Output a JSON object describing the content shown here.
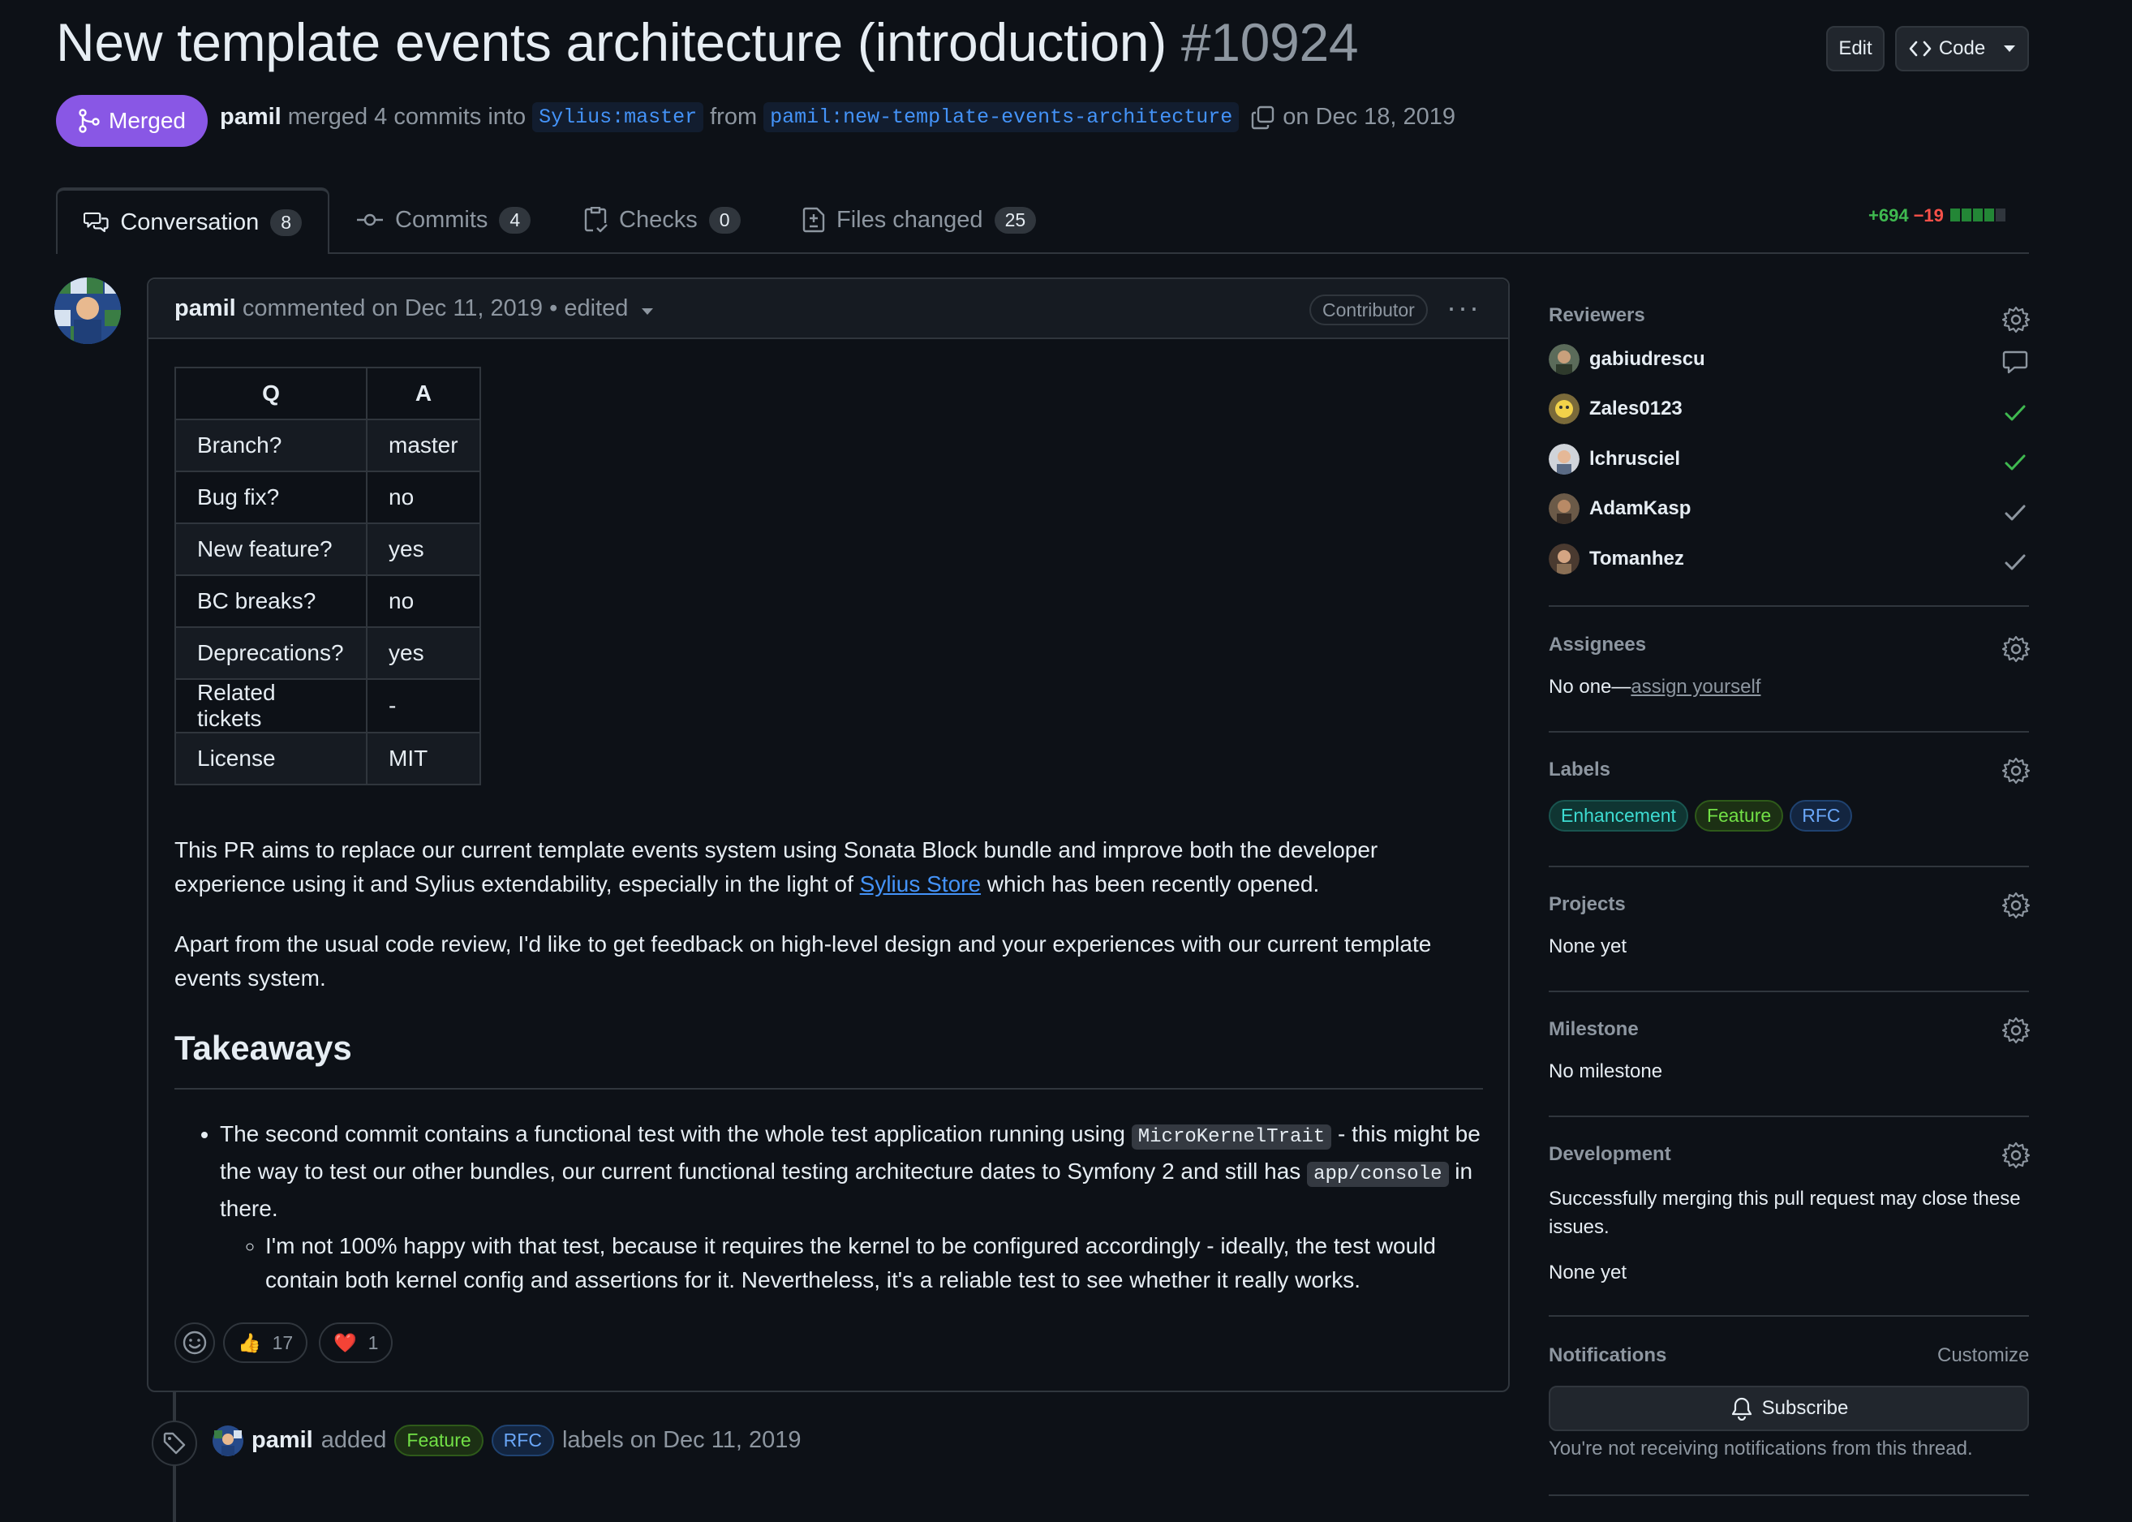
{
  "pr": {
    "title": "New template events architecture (introduction)",
    "number": "#10924",
    "edit_label": "Edit",
    "code_label": "Code",
    "state": "Merged",
    "author": "pamil",
    "merge_text": "merged 4 commits into",
    "base_branch": "Sylius:master",
    "from_text": "from",
    "head_branch": "pamil:new-template-events-architecture",
    "merged_on": "on Dec 18, 2019"
  },
  "tabs": [
    {
      "label": "Conversation",
      "count": "8"
    },
    {
      "label": "Commits",
      "count": "4"
    },
    {
      "label": "Checks",
      "count": "0"
    },
    {
      "label": "Files changed",
      "count": "25"
    }
  ],
  "diffstat": {
    "additions": "+694",
    "deletions": "−19"
  },
  "comment": {
    "author": "pamil",
    "meta": "commented on Dec 11, 2019 • edited",
    "role": "Contributor",
    "table": {
      "headers": [
        "Q",
        "A"
      ],
      "rows": [
        [
          "Branch?",
          "master"
        ],
        [
          "Bug fix?",
          "no"
        ],
        [
          "New feature?",
          "yes"
        ],
        [
          "BC breaks?",
          "no"
        ],
        [
          "Deprecations?",
          "yes"
        ],
        [
          "Related tickets",
          "-"
        ],
        [
          "License",
          "MIT"
        ]
      ]
    },
    "p1_before": "This PR aims to replace our current template events system using Sonata Block bundle and improve both the developer experience using it and Sylius extendability, especially in the light of ",
    "p1_link": "Sylius Store",
    "p1_after": " which has been recently opened.",
    "p2": "Apart from the usual code review, I'd like to get feedback on high-level design and your experiences with our current template events system.",
    "heading": "Takeaways",
    "bullet1_a": "The second commit contains a functional test with the whole test application running using ",
    "bullet1_code1": "MicroKernelTrait",
    "bullet1_b": " - this might be the way to test our other bundles, our current functional testing architecture dates to Symfony 2 and still has ",
    "bullet1_code2": "app/console",
    "bullet1_c": " in there.",
    "bullet2": "I'm not 100% happy with that test, because it requires the kernel to be configured accordingly - ideally, the test would contain both kernel config and assertions for it. Nevertheless, it's a reliable test to see whether it really works.",
    "reactions": [
      {
        "emoji": "👍",
        "count": "17"
      },
      {
        "emoji": "❤️",
        "count": "1"
      }
    ]
  },
  "event": {
    "author": "pamil",
    "action": "added",
    "labels": [
      "Feature",
      "RFC"
    ],
    "suffix": "labels on Dec 11, 2019"
  },
  "sidebar": {
    "reviewers_title": "Reviewers",
    "reviewers": [
      {
        "name": "gabiudrescu",
        "status": "commented"
      },
      {
        "name": "Zales0123",
        "status": "approved"
      },
      {
        "name": "lchrusciel",
        "status": "approved"
      },
      {
        "name": "AdamKasp",
        "status": "approved-outdated"
      },
      {
        "name": "Tomanhez",
        "status": "approved-outdated"
      }
    ],
    "assignees_title": "Assignees",
    "assignees_none": "No one—",
    "assign_yourself": "assign yourself",
    "labels_title": "Labels",
    "labels": [
      "Enhancement",
      "Feature",
      "RFC"
    ],
    "projects_title": "Projects",
    "projects_value": "None yet",
    "milestone_title": "Milestone",
    "milestone_value": "No milestone",
    "development_title": "Development",
    "development_text": "Successfully merging this pull request may close these issues.",
    "development_value": "None yet",
    "notifications_title": "Notifications",
    "customize_label": "Customize",
    "subscribe_label": "Subscribe",
    "notifications_text": "You're not receiving notifications from this thread."
  },
  "colors": {
    "merged": "#8957e5",
    "background": "#0d1117",
    "link": "#4493f8",
    "approved": "#3fb950"
  }
}
